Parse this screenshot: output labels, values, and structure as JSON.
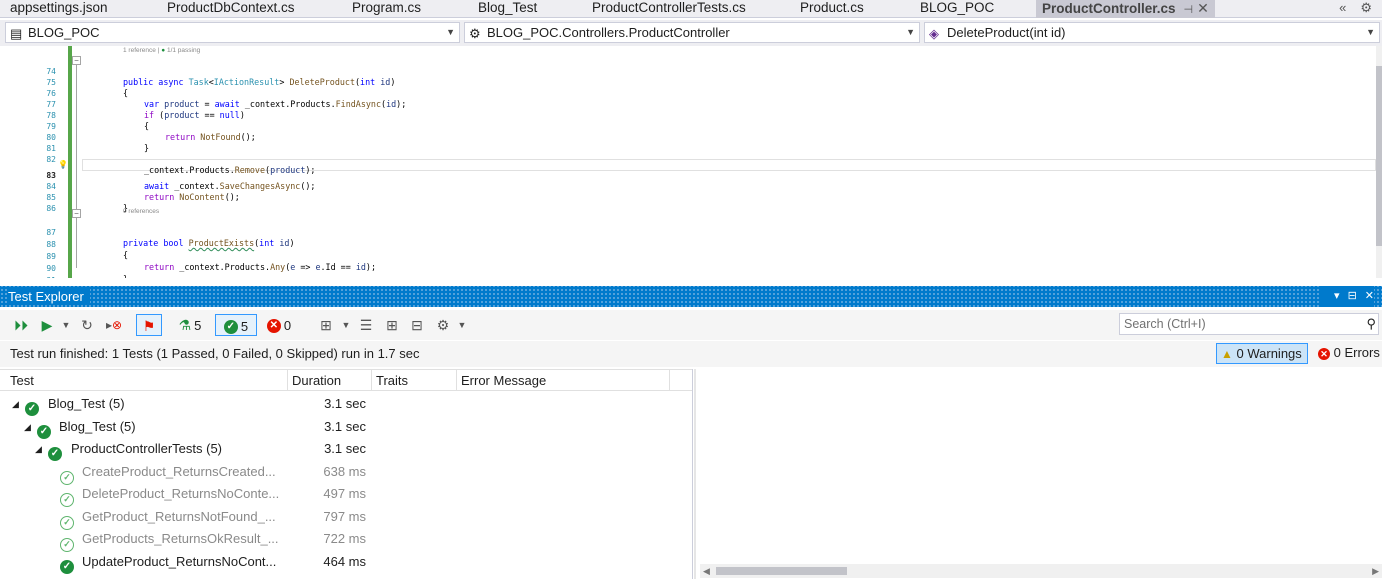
{
  "tabs": [
    {
      "label": "appsettings.json"
    },
    {
      "label": "ProductDbContext.cs"
    },
    {
      "label": "Program.cs"
    },
    {
      "label": "Blog_Test"
    },
    {
      "label": "ProductControllerTests.cs"
    },
    {
      "label": "Product.cs"
    },
    {
      "label": "BLOG_POC"
    },
    {
      "label": "ProductController.cs",
      "active": true
    }
  ],
  "nav": {
    "project": "BLOG_POC",
    "class": "BLOG_POC.Controllers.ProductController",
    "member": "DeleteProduct(int id)"
  },
  "editor": {
    "codelens_top_refs": "1 reference",
    "codelens_top_sep": " | ",
    "codelens_top_passing": "1/1 passing",
    "codelens_bottom": "0 references",
    "lines": [
      {
        "num": "74",
        "text": "public async Task<IActionResult> DeleteProduct(int id)"
      },
      {
        "num": "75",
        "text": "{"
      },
      {
        "num": "76",
        "text": "var product = await _context.Products.FindAsync(id);"
      },
      {
        "num": "77",
        "text": "if (product == null)"
      },
      {
        "num": "78",
        "text": "{"
      },
      {
        "num": "79",
        "text": "return NotFound();"
      },
      {
        "num": "80",
        "text": "}"
      },
      {
        "num": "81",
        "text": ""
      },
      {
        "num": "82",
        "text": "_context.Products.Remove(product);"
      },
      {
        "num": "83",
        "text": "await _context.SaveChangesAsync();"
      },
      {
        "num": "84",
        "text": "return NoContent();"
      },
      {
        "num": "85",
        "text": "}"
      },
      {
        "num": "86",
        "text": ""
      },
      {
        "num": "87",
        "text": "private bool ProductExists(int id)"
      },
      {
        "num": "88",
        "text": "{"
      },
      {
        "num": "89",
        "text": "return _context.Products.Any(e => e.Id == id);"
      },
      {
        "num": "90",
        "text": "}"
      },
      {
        "num": "91",
        "text": "}"
      }
    ]
  },
  "test_explorer": {
    "title": "Test Explorer",
    "toolbar": {
      "total_count": "5",
      "passed_count": "5",
      "failed_count": "0"
    },
    "search_placeholder": "Search (Ctrl+I)",
    "status_text": "Test run finished: 1 Tests (1 Passed, 0 Failed, 0 Skipped) run in 1.7 sec",
    "warnings": "0 Warnings",
    "errors": "0 Errors",
    "columns": [
      "Test",
      "Duration",
      "Traits",
      "Error Message"
    ],
    "rows": [
      {
        "name": "Blog_Test  (5)",
        "duration": "3.1 sec",
        "level": 0
      },
      {
        "name": "Blog_Test  (5)",
        "duration": "3.1 sec",
        "level": 1
      },
      {
        "name": "ProductControllerTests  (5)",
        "duration": "3.1 sec",
        "level": 2
      },
      {
        "name": "CreateProduct_ReturnsCreated...",
        "duration": "638 ms",
        "level": 3
      },
      {
        "name": "DeleteProduct_ReturnsNoConte...",
        "duration": "497 ms",
        "level": 3
      },
      {
        "name": "GetProduct_ReturnsNotFound_...",
        "duration": "797 ms",
        "level": 3
      },
      {
        "name": "GetProducts_ReturnsOkResult_...",
        "duration": "722 ms",
        "level": 3
      },
      {
        "name": "UpdateProduct_ReturnsNoCont...",
        "duration": "464 ms",
        "level": 3
      }
    ]
  },
  "colors": {
    "accent": "#007acc",
    "pass": "#1e8f3d",
    "fail": "#e51400"
  }
}
